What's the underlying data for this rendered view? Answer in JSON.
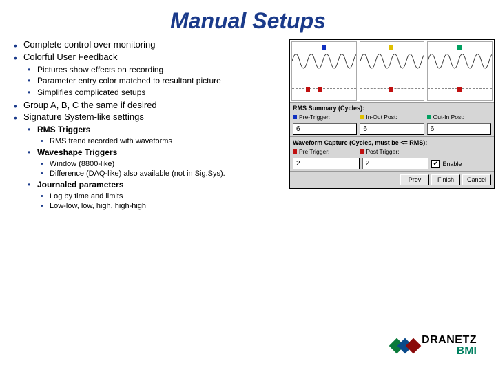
{
  "title": "Manual Setups",
  "bullets": {
    "b1": "Complete control over monitoring",
    "b2": "Colorful User Feedback",
    "b2a": "Pictures show effects on recording",
    "b2b": "Parameter entry color matched to resultant picture",
    "b2c": "Simplifies complicated setups",
    "b3": "Group A, B, C the same if desired",
    "b4": "Signature System-like settings",
    "b4a": "RMS Triggers",
    "b4a1": "RMS trend recorded with waveforms",
    "b4b": "Waveshape Triggers",
    "b4b1": "Window (8800-like)",
    "b4b2": "Difference (DAQ-like) also available (not in Sig.Sys).",
    "b4c": "Journaled parameters",
    "b4c1": "Log by time and limits",
    "b4c2": "Low-low, low, high, high-high"
  },
  "panel": {
    "rms_section": "RMS Summary (Cycles):",
    "leg_pre": "Pre-Trigger:",
    "leg_inout": "In-Out Post:",
    "leg_outin": "Out-In Post:",
    "rms_v1": "6",
    "rms_v2": "6",
    "rms_v3": "6",
    "wave_section": "Waveform Capture (Cycles, must be <= RMS):",
    "leg_pre2": "Pre Trigger:",
    "leg_post": "Post Trigger:",
    "wave_v1": "2",
    "wave_v2": "2",
    "enable": "Enable",
    "btn_prev": "Prev",
    "btn_finish": "Finish",
    "btn_cancel": "Cancel"
  },
  "logo": {
    "top": "DRANETZ",
    "bot": "BMI"
  }
}
